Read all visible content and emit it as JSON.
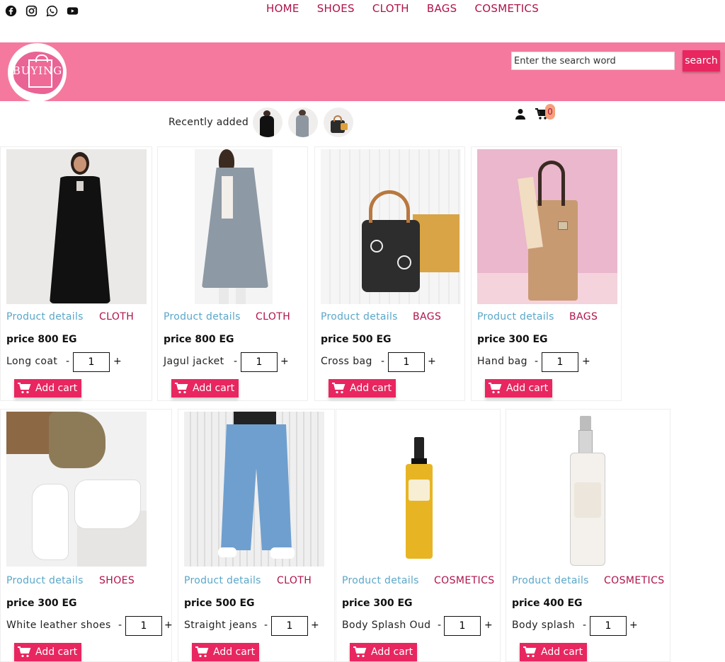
{
  "nav": {
    "social": [
      {
        "icon": "facebook-icon"
      },
      {
        "icon": "instagram-icon"
      },
      {
        "icon": "whatsapp-icon"
      },
      {
        "icon": "youtube-icon"
      }
    ],
    "links": [
      "HOME",
      "SHOES",
      "CLOTH",
      "BAGS",
      "COSMETICS"
    ]
  },
  "header": {
    "logo_text": "BUYING",
    "search_placeholder": "Enter the search word",
    "search_label": "search"
  },
  "recent": {
    "label": "Recently added",
    "thumbs": [
      "black-coat-thumb",
      "grey-jacket-thumb",
      "bag-thumb"
    ]
  },
  "account": {
    "cart_count": "0"
  },
  "products": [
    {
      "details": "Product details",
      "category": "CLOTH",
      "price": "price 800 EG",
      "name": "Long coat",
      "qty": "1",
      "add": "Add cart"
    },
    {
      "details": "Product details",
      "category": "CLOTH",
      "price": "price 800 EG",
      "name": "Jagul jacket",
      "qty": "1",
      "add": "Add cart"
    },
    {
      "details": "Product details",
      "category": "BAGS",
      "price": "price 500 EG",
      "name": "Cross bag",
      "qty": "1",
      "add": "Add cart"
    },
    {
      "details": "Product details",
      "category": "BAGS",
      "price": "price 300 EG",
      "name": "Hand bag",
      "qty": "1",
      "add": "Add cart"
    },
    {
      "details": "Product details",
      "category": "SHOES",
      "price": "price 300 EG",
      "name": "White leather shoes",
      "qty": "1",
      "add": "Add cart"
    },
    {
      "details": "Product details",
      "category": "CLOTH",
      "price": "price 500 EG",
      "name": "Straight jeans",
      "qty": "1",
      "add": "Add cart"
    },
    {
      "details": "Product details",
      "category": "COSMETICS",
      "price": "price 300 EG",
      "name": "Body Splash Oud",
      "qty": "1",
      "add": "Add cart"
    },
    {
      "details": "Product details",
      "category": "COSMETICS",
      "price": "price 400 EG",
      "name": "Body splash",
      "qty": "1",
      "add": "Add cart"
    }
  ],
  "colors": {
    "brand_pink": "#f5799e",
    "accent": "#e8265f",
    "nav_text": "#b0124a",
    "details_link": "#5aa7c9"
  }
}
